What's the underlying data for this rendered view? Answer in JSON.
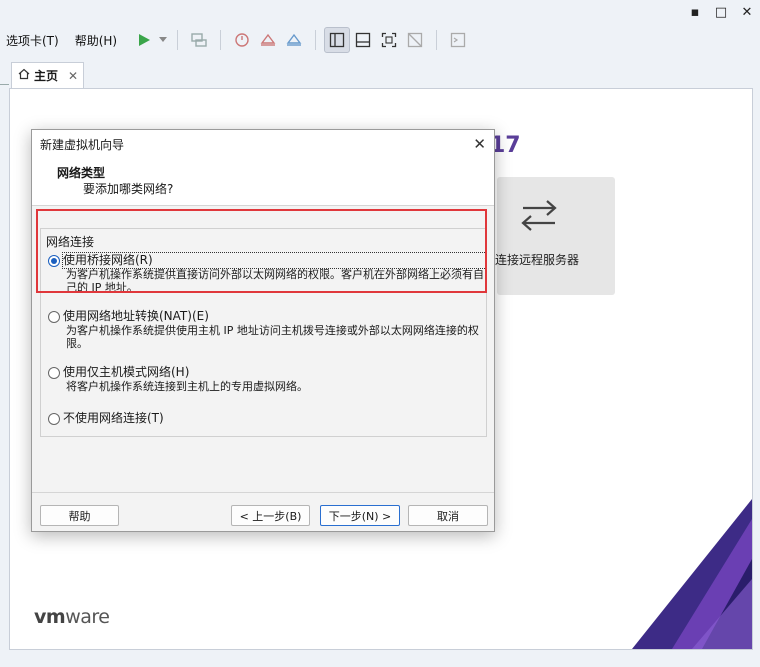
{
  "window_controls": {
    "minimize": "▪",
    "maximize": "□",
    "close": "✕"
  },
  "menu": {
    "tabs_label": "选项卡(T)",
    "help_label": "帮助(H)"
  },
  "tabs": [
    {
      "label": "主页",
      "close": "✕"
    }
  ],
  "home": {
    "product_version": "17",
    "remote_card_label": "连接远程服务器",
    "logo_prefix": "vm",
    "logo_suffix": "ware"
  },
  "dialog": {
    "title": "新建虚拟机向导",
    "close": "✕",
    "heading": "网络类型",
    "subheading": "要添加哪类网络?",
    "group_label": "网络连接",
    "options": [
      {
        "label": "使用桥接网络(R)",
        "desc": "为客户机操作系统提供直接访问外部以太网网络的权限。客户机在外部网络上必须有自己的 IP 地址。",
        "checked": true
      },
      {
        "label": "使用网络地址转换(NAT)(E)",
        "desc": "为客户机操作系统提供使用主机 IP 地址访问主机拨号连接或外部以太网网络连接的权限。",
        "checked": false
      },
      {
        "label": "使用仅主机模式网络(H)",
        "desc": "将客户机操作系统连接到主机上的专用虚拟网络。",
        "checked": false
      },
      {
        "label": "不使用网络连接(T)",
        "desc": "",
        "checked": false
      }
    ],
    "buttons": {
      "help": "帮助",
      "back": "< 上一步(B)",
      "next": "下一步(N) >",
      "cancel": "取消"
    }
  },
  "colors": {
    "highlight_border": "#e0373b",
    "accent_purple": "#5a3e99",
    "play_green": "#3aa54a"
  }
}
